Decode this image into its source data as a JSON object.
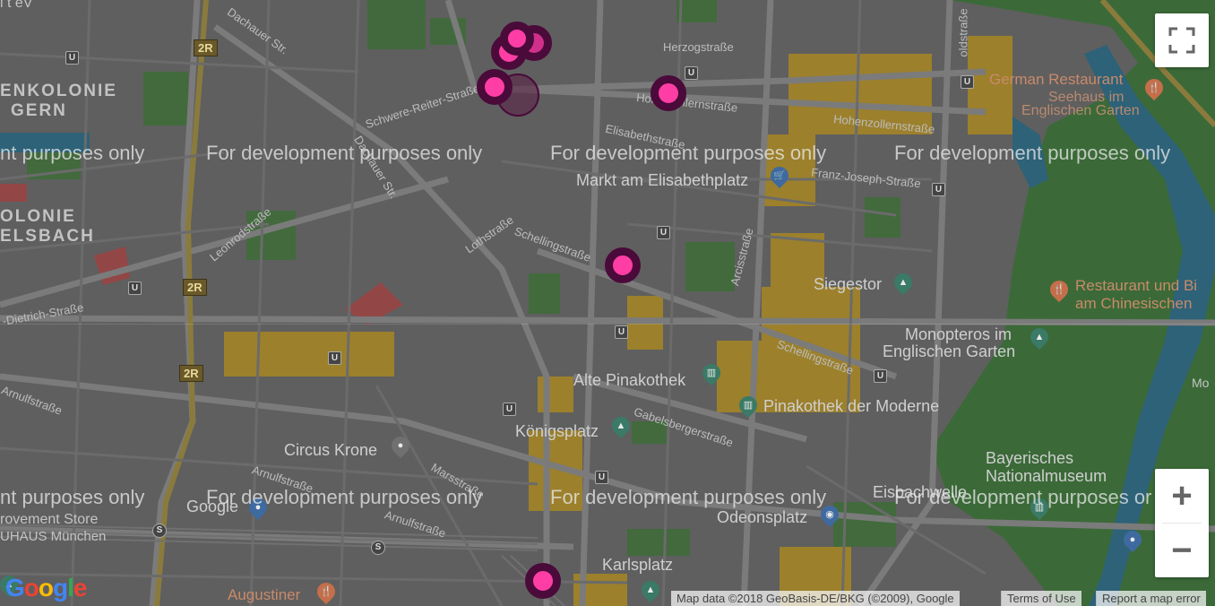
{
  "map": {
    "watermark": "For development purposes only",
    "watermark_partial_left": "nt purposes only",
    "watermark_partial_right": "For development purposes or",
    "places": {
      "german_restaurant": "German Restaurant",
      "seehaus": "Seehaus im",
      "englischen_garten": "Englischen Garten",
      "markt": "Markt am Elisabethplatz",
      "siegestor": "Siegestor",
      "restaurant_und_bi": "Restaurant und Bi",
      "am_chinesischen": "am Chinesischen",
      "monopteros": "Monopteros im",
      "monopteros2": "Englischen Garten",
      "alte_pinakothek": "Alte Pinakothek",
      "pinakothek_moderne": "Pinakothek der Moderne",
      "koenigsplatz": "Königsplatz",
      "circus_krone": "Circus Krone",
      "bayerisches": "Bayerisches",
      "nationalmuseum": "Nationalmuseum",
      "google": "Google",
      "eisbachwelle": "Eisbachwelle",
      "odeonsplatz": "Odeonsplatz",
      "karlsplatz": "Karlsplatz",
      "augustiner": "Augustiner",
      "improvement_store": "rovement Store",
      "bauhaus": "UHAUS München",
      "gartenkolonie": "ENKOLONIE",
      "gern": "GERN",
      "kolonie": "OLONIE",
      "elsbach": "ELSBACH",
      "lt_ev": "l t eV",
      "mo": "Mo"
    },
    "streets": {
      "dachauer1": "Dachauer Str.",
      "dachauer2": "Dachauer Str.",
      "herzog": "Herzogstraße",
      "hohenzollern1": "Hohenzollernstraße",
      "hohenzollern2": "Hohenzollernstraße",
      "elisabeth": "Elisabethstraße",
      "franz_joseph": "Franz-Joseph-Straße",
      "schwere_reiter": "Schwere-Reiter-Straße",
      "leonrod": "Leonrodstraße",
      "loth": "Lothstraße",
      "schelling1": "Schellingstraße",
      "schelling2": "Schellingstraße",
      "arcis": "Arcisstraße",
      "dietrich": "-Dietrich-Straße",
      "arnulf1": "Arnulfstraße",
      "arnulf2": "Arnulfstraße",
      "arnulf3": "Arnulfstraße",
      "gabelsberger": "Gabelsbergerstraße",
      "marsstr": "Marsstraße",
      "goldstr": "oldstraße"
    },
    "road_shields": [
      "2R",
      "2R",
      "2R"
    ],
    "transit": {
      "ubahn": "U",
      "sbahn": "S"
    }
  },
  "controls": {
    "fullscreen_icon": "fullscreen-icon",
    "zoom_in": "+",
    "zoom_out": "−"
  },
  "attribution": {
    "google_logo": "Google",
    "map_data": "Map data ©2018 GeoBasis-DE/BKG (©2009), Google",
    "terms": "Terms of Use",
    "report": "Report a map error"
  },
  "colors": {
    "marker_fill": "#ff3ea5",
    "marker_ring": "#4a0a3a",
    "park": "#3e7a3a",
    "building": "#a8892c",
    "water": "#2f6f8c"
  }
}
